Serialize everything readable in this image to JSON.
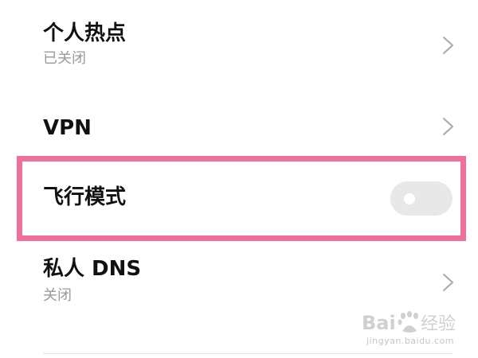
{
  "settings": {
    "items": [
      {
        "title": "个人热点",
        "subtitle": "已关闭"
      },
      {
        "title": "VPN"
      },
      {
        "title": "飞行模式",
        "toggle_on": false
      },
      {
        "title": "私人 DNS",
        "subtitle": "关闭"
      }
    ]
  },
  "highlight_color": "#f0709a",
  "icons": {
    "chevron": "chevron-right-icon"
  },
  "watermark": {
    "logo_text": "Baidu经验",
    "url": "jingyan.baidu.com"
  }
}
